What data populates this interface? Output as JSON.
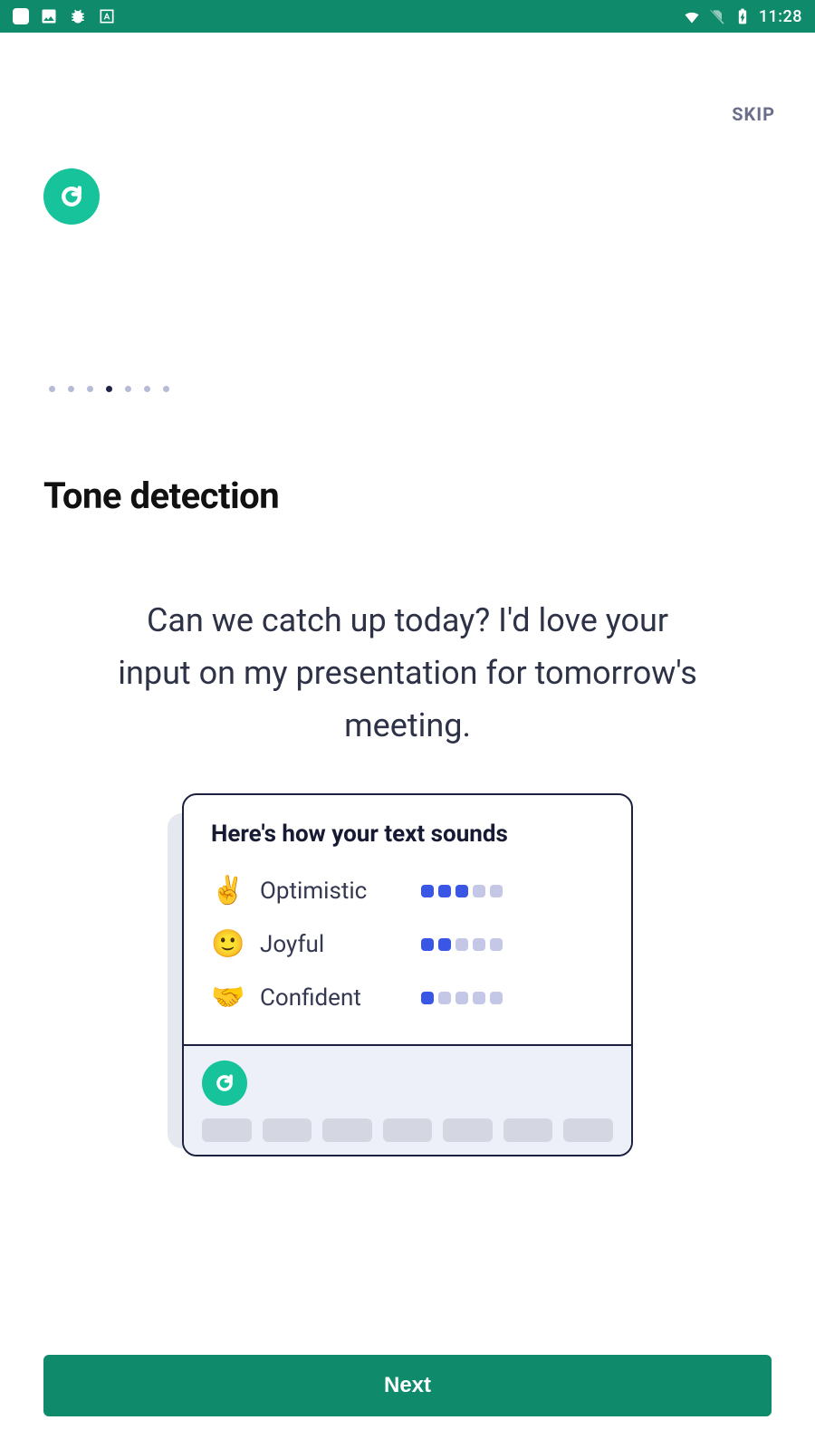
{
  "statusbar": {
    "time": "11:28"
  },
  "skip_label": "SKIP",
  "pagination": {
    "count": 7,
    "active_index": 3
  },
  "title": "Tone detection",
  "example_text": "Can we catch up today? I'd love your input on my presentation for tomorrow's meeting.",
  "card": {
    "heading": "Here's how your text sounds",
    "tones": [
      {
        "emoji": "✌️",
        "label": "Optimistic",
        "level": 3,
        "max": 5
      },
      {
        "emoji": "🙂",
        "label": "Joyful",
        "level": 2,
        "max": 5
      },
      {
        "emoji": "🤝",
        "label": "Confident",
        "level": 1,
        "max": 5
      }
    ]
  },
  "next_label": "Next"
}
